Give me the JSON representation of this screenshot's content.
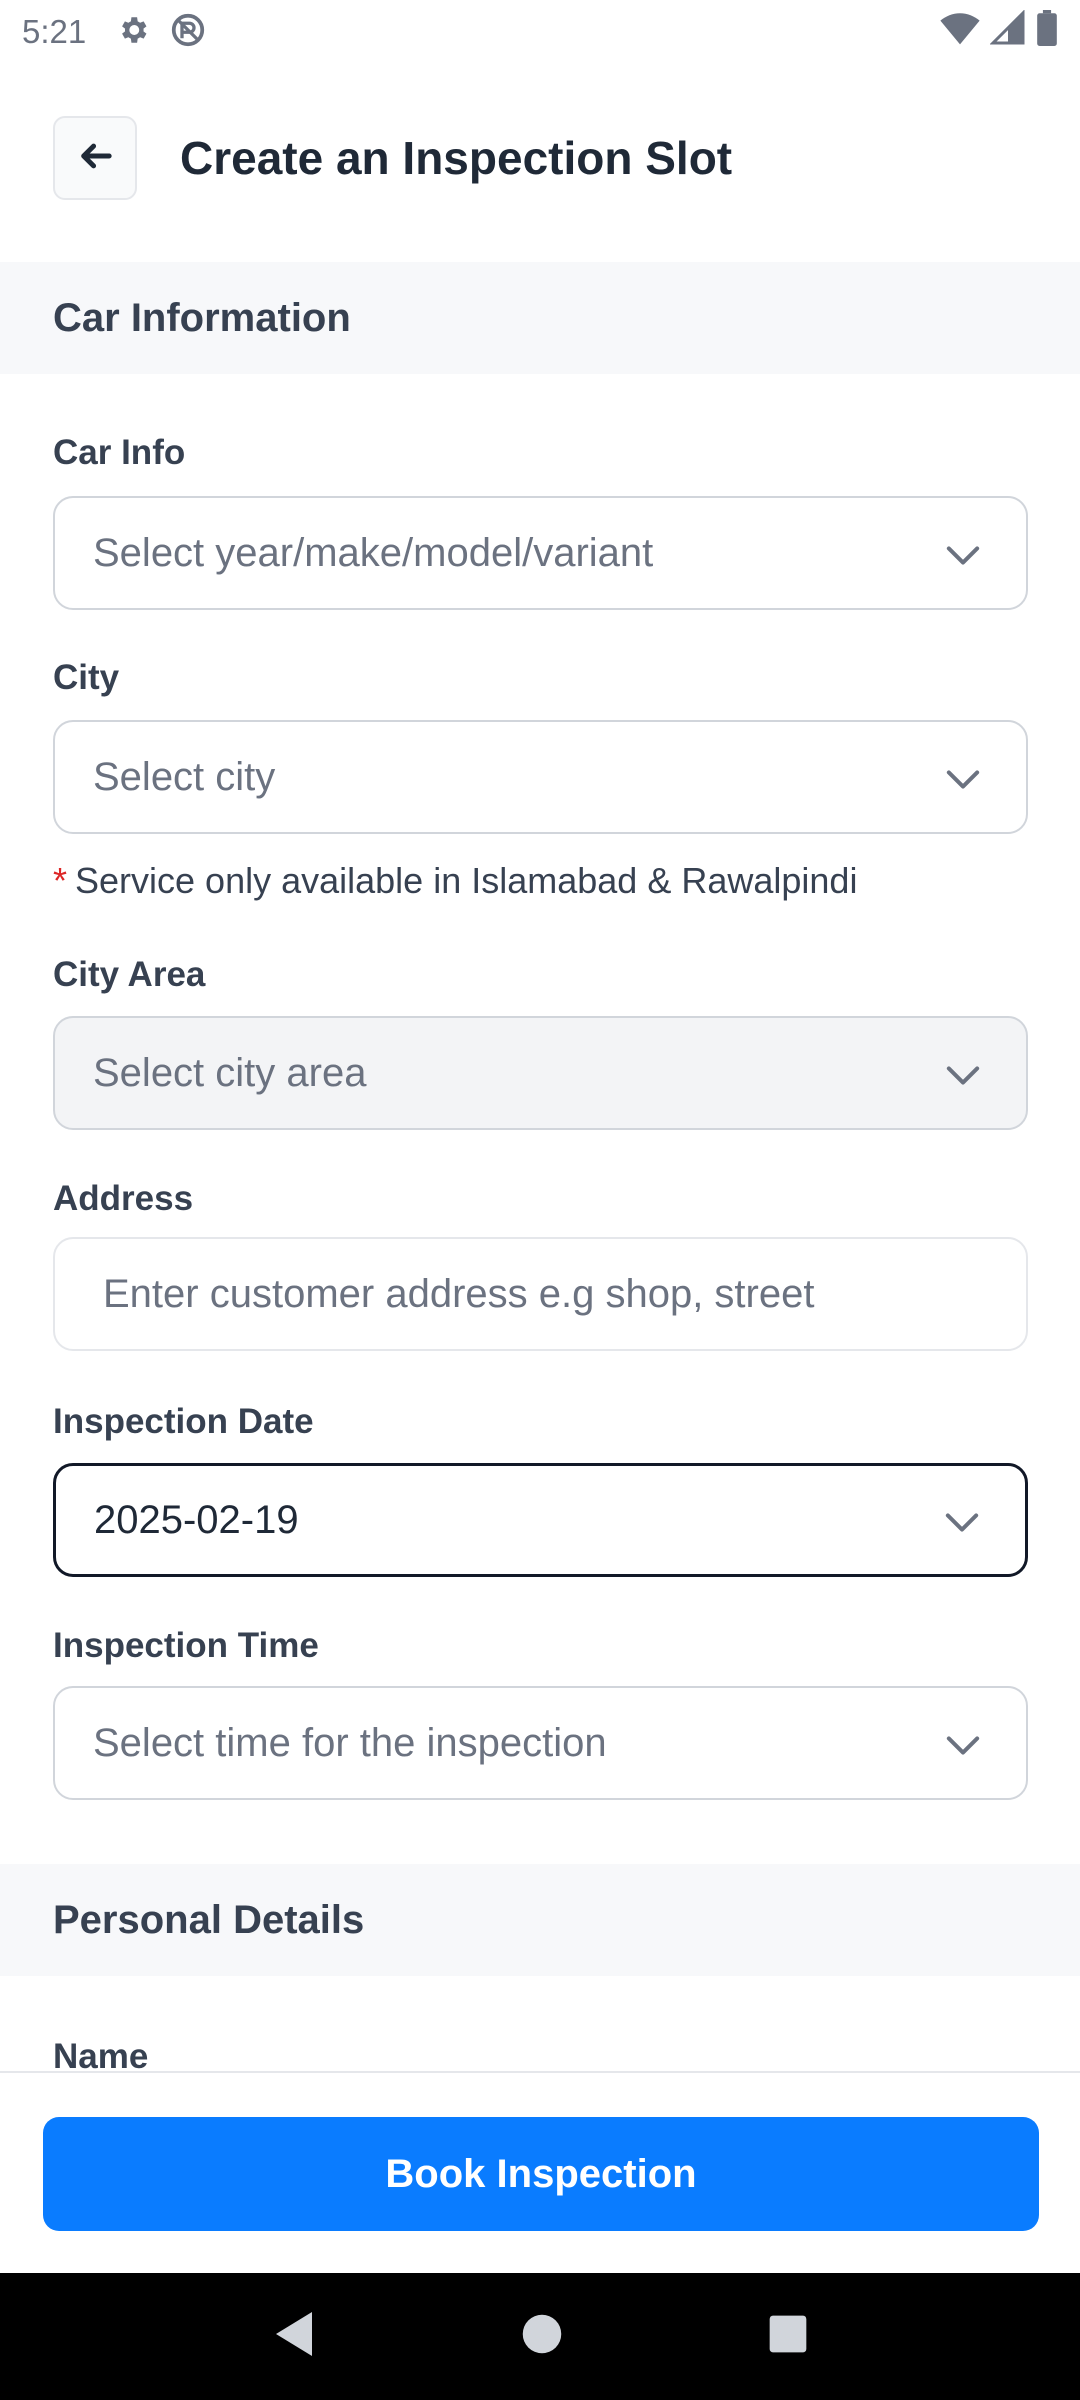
{
  "status_bar": {
    "time": "5:21",
    "icons_left": [
      "gear-icon",
      "no-sync-icon"
    ],
    "icons_right": [
      "wifi-icon",
      "signal-icon",
      "battery-icon"
    ]
  },
  "header": {
    "title": "Create an Inspection Slot",
    "back_icon": "arrow-left-icon"
  },
  "sections": {
    "car_information": "Car Information",
    "personal_details": "Personal Details"
  },
  "fields": {
    "car_info": {
      "label": "Car Info",
      "placeholder": "Select year/make/model/variant"
    },
    "city": {
      "label": "City",
      "placeholder": "Select city"
    },
    "city_note": {
      "star": "*",
      "text": "Service only available in Islamabad & Rawalpindi"
    },
    "city_area": {
      "label": "City Area",
      "placeholder": "Select city area"
    },
    "address": {
      "label": "Address",
      "placeholder": "Enter customer address e.g shop, street"
    },
    "inspection_date": {
      "label": "Inspection Date",
      "value": "2025-02-19"
    },
    "inspection_time": {
      "label": "Inspection Time",
      "placeholder": "Select time for the inspection"
    },
    "name": {
      "label": "Name"
    }
  },
  "actions": {
    "book_label": "Book Inspection"
  },
  "colors": {
    "primary": "#0a7cff",
    "required_star": "#dc2626",
    "section_bg": "#f7f8fa"
  },
  "nav_bar": [
    "back-triangle-icon",
    "home-circle-icon",
    "recents-square-icon"
  ]
}
